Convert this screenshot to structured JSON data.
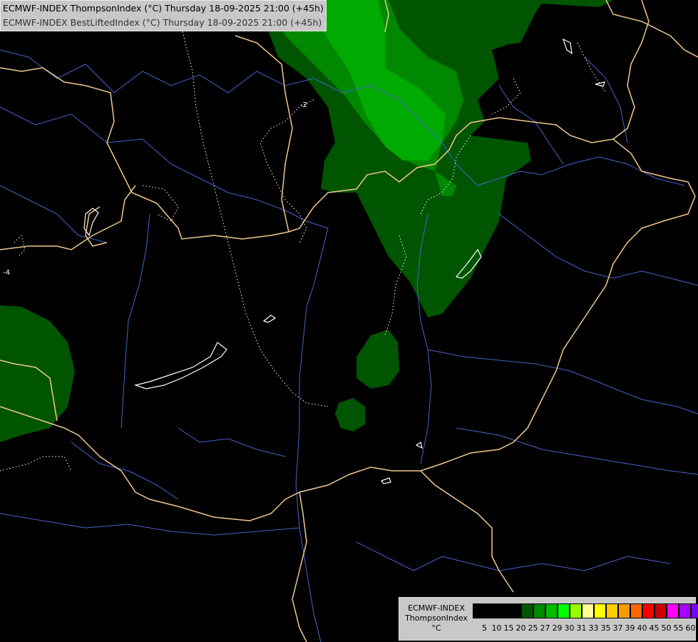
{
  "title": {
    "line1": "ECMWF-INDEX ThompsonIndex (°C) Thursday 18-09-2025 21:00 (+45h)",
    "line2": "ECMWF-INDEX BestLiftedIndex (°C) Thursday 18-09-2025 21:00 (+45h)"
  },
  "contour_labels": {
    "a": "-2",
    "b": "-4"
  },
  "legend": {
    "caption_line1": "ECMWF-INDEX",
    "caption_line2": "ThompsonIndex",
    "caption_line3": "°C",
    "colors": [
      "#000000",
      "#000000",
      "#000000",
      "#000000",
      "#005500",
      "#008800",
      "#00bb00",
      "#00ff00",
      "#99ff00",
      "#ffff99",
      "#ffff00",
      "#ffcc00",
      "#ff9900",
      "#ff6600",
      "#ff0000",
      "#cc0000",
      "#ff00ff",
      "#aa00ff",
      "#7700ff",
      "#4400ff",
      "#0000ff"
    ],
    "ticks": [
      "5",
      "10",
      "15",
      "20",
      "25",
      "27",
      "29",
      "30",
      "31",
      "33",
      "35",
      "37",
      "39",
      "40",
      "45",
      "50",
      "55",
      "60"
    ]
  },
  "colors": {
    "background": "#000000",
    "border": "#f0c890",
    "river": "#4466cc",
    "green_dark": "#005500",
    "green_mid": "#008800",
    "green_light": "#00aa00"
  }
}
